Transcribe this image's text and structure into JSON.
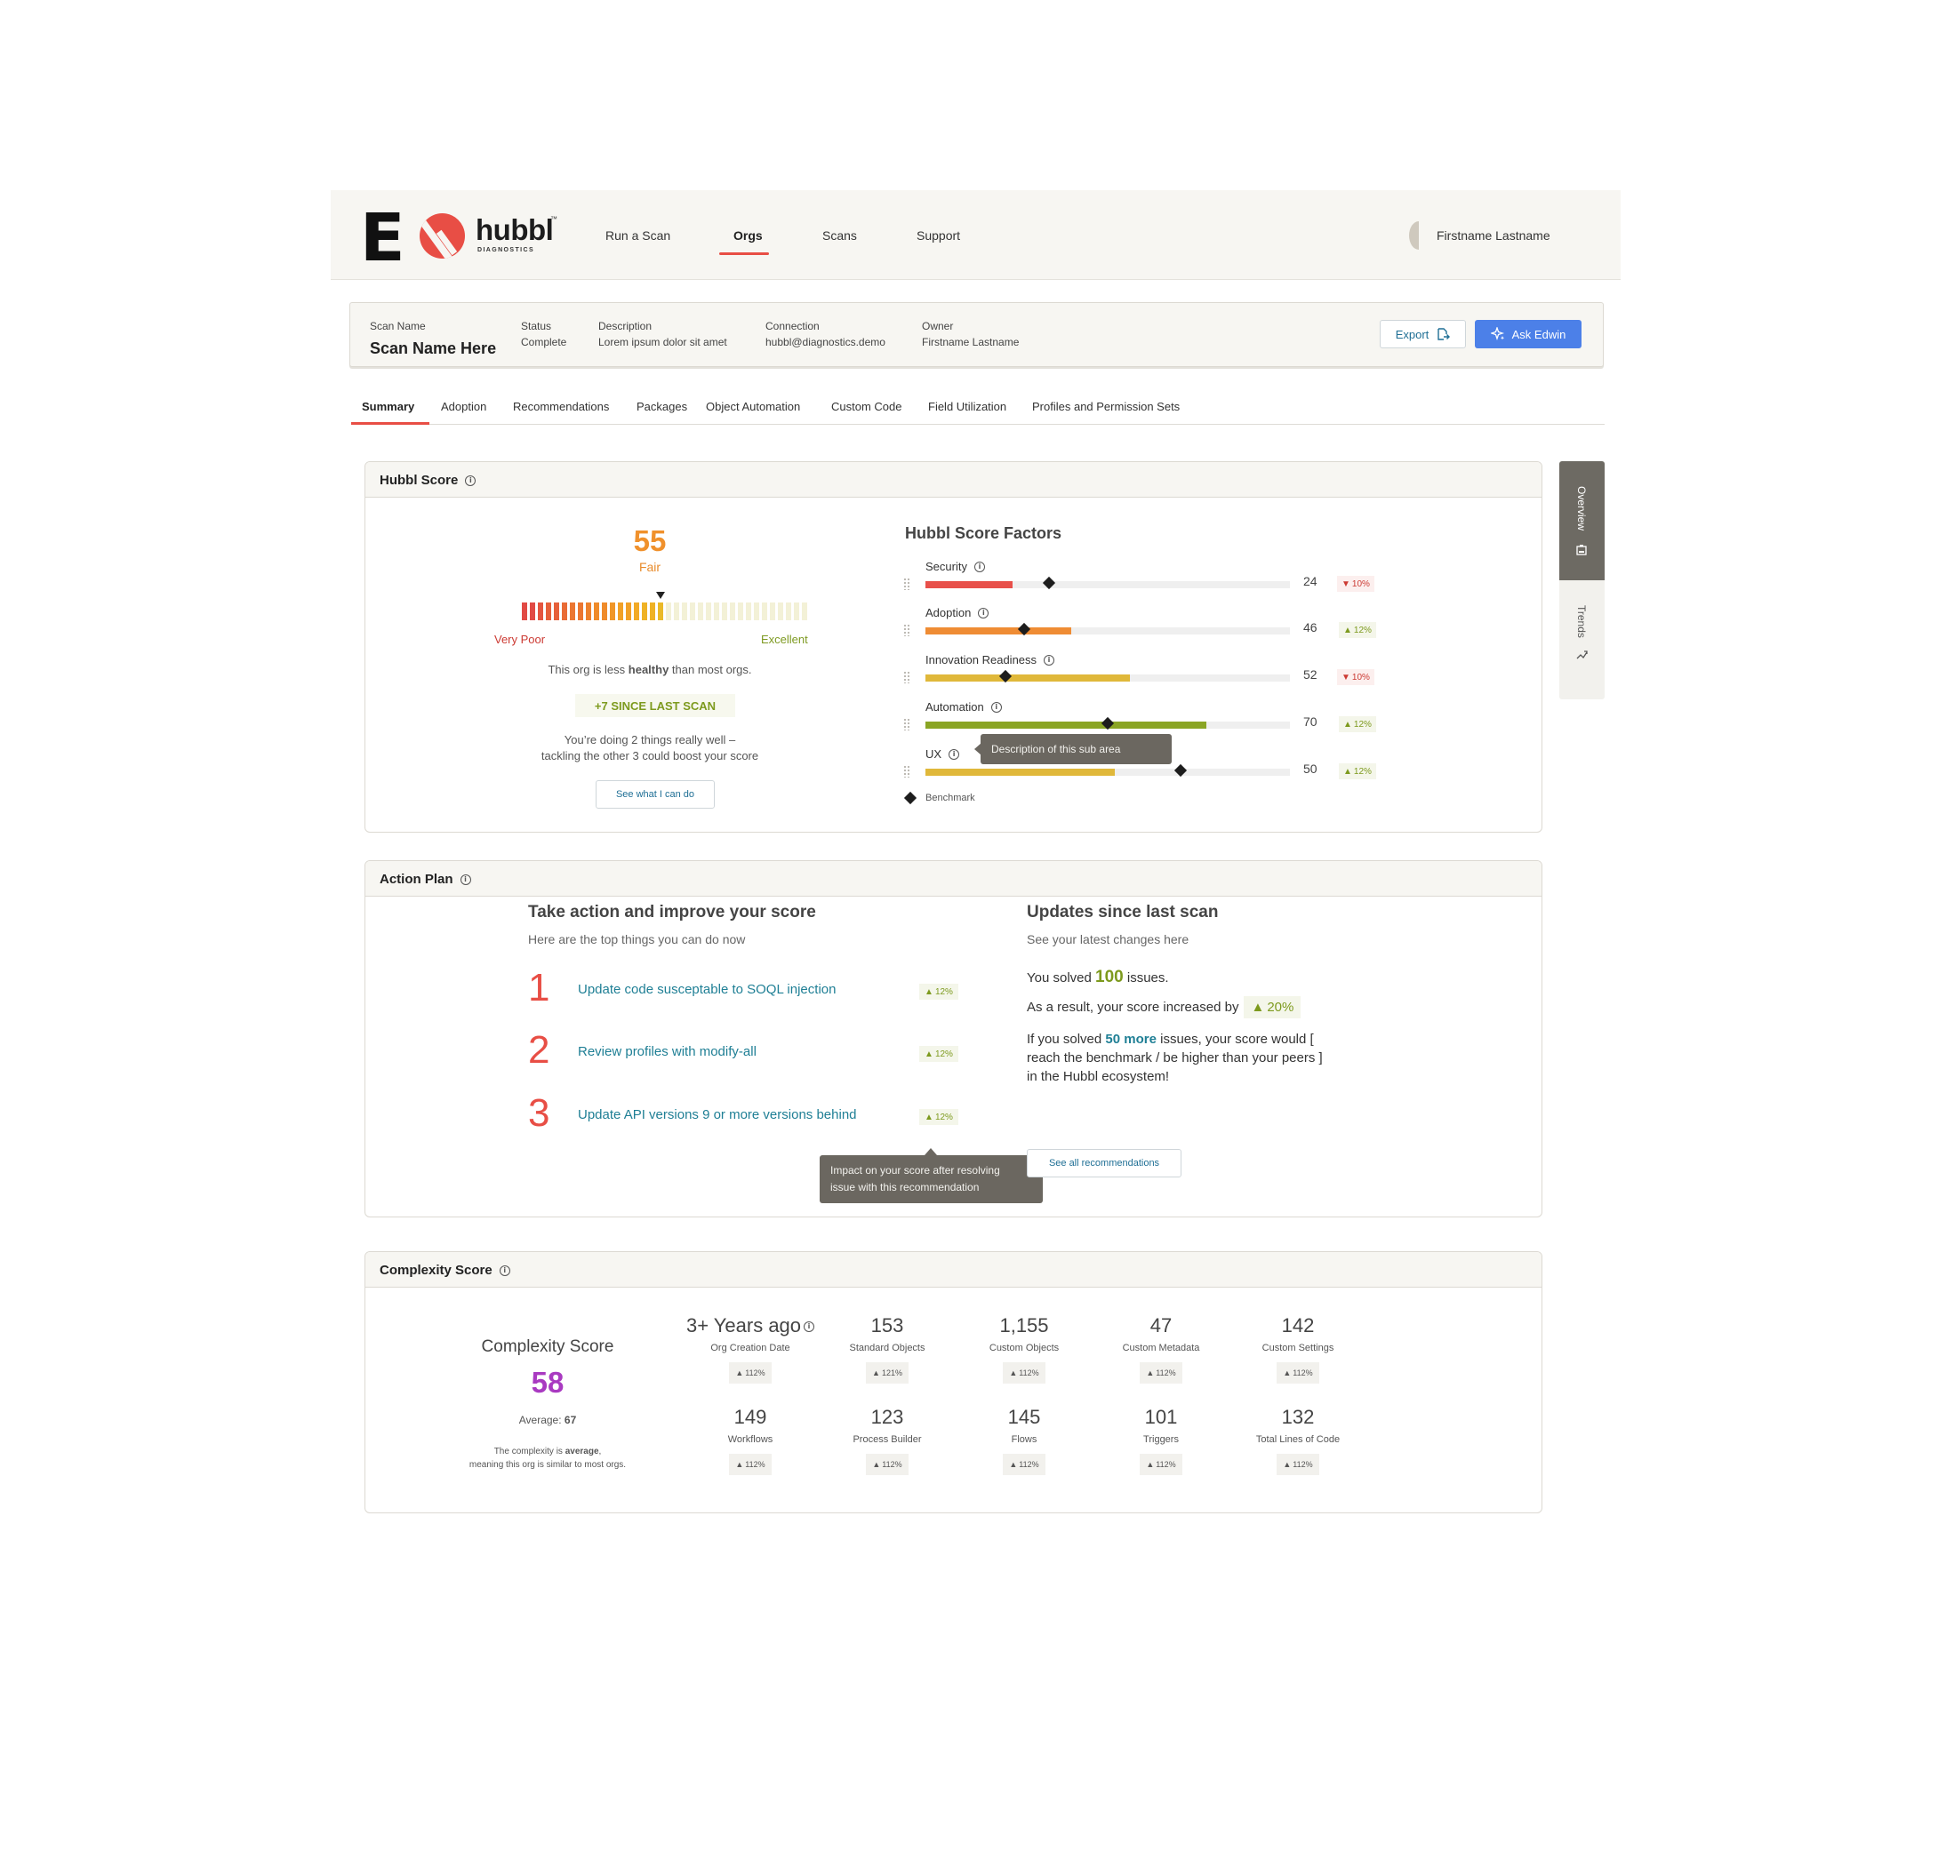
{
  "header": {
    "logo_letter": "E",
    "brand": "hubbl",
    "brand_tm": "™",
    "brand_sub": "DIAGNOSTICS",
    "nav": [
      "Run a Scan",
      "Orgs",
      "Scans",
      "Support"
    ],
    "active_nav": "Orgs",
    "user_name": "Firstname Lastname"
  },
  "scan": {
    "name_label": "Scan Name",
    "name": "Scan Name Here",
    "status_label": "Status",
    "status": "Complete",
    "description_label": "Description",
    "description": "Lorem ipsum dolor sit amet",
    "connection_label": "Connection",
    "connection": "hubbl@diagnostics.demo",
    "owner_label": "Owner",
    "owner": "Firstname Lastname",
    "export_label": "Export",
    "ask_label": "Ask Edwin"
  },
  "tabs": [
    "Summary",
    "Adoption",
    "Recommendations",
    "Packages",
    "Object Automation",
    "Custom Code",
    "Field Utilization",
    "Profiles and Permission Sets"
  ],
  "side_tabs": {
    "overview": "Overview",
    "trends": "Trends"
  },
  "hubbl_score": {
    "title": "Hubbl Score",
    "score": "55",
    "rating": "Fair",
    "gauge_level": 0.5,
    "low_label": "Very Poor",
    "high_label": "Excellent",
    "health_prefix": "This org is less ",
    "health_strong": "healthy",
    "health_suffix": " than most orgs.",
    "since_last": "+7 SINCE LAST SCAN",
    "doing_line1": "You’re doing 2 things really well –",
    "doing_line2": "tackling the other 3 could boost your score",
    "see_button": "See what I can do",
    "factors_title": "Hubbl Score Factors",
    "factors": [
      {
        "name": "Security",
        "value": "24",
        "score": 24,
        "benchmark": 34,
        "delta": "10%",
        "direction": "down",
        "color": "#e8504a"
      },
      {
        "name": "Adoption",
        "value": "46",
        "score": 40,
        "benchmark": 27,
        "delta": "12%",
        "direction": "up",
        "color": "#ef8c34"
      },
      {
        "name": "Innovation Readiness",
        "value": "52",
        "score": 56,
        "benchmark": 22,
        "delta": "10%",
        "direction": "down",
        "color": "#e0b83a"
      },
      {
        "name": "Automation",
        "value": "70",
        "score": 77,
        "benchmark": 50,
        "delta": "12%",
        "direction": "up",
        "color": "#8aa524"
      },
      {
        "name": "UX",
        "value": "50",
        "score": 52,
        "benchmark": 70,
        "delta": "12%",
        "direction": "up",
        "color": "#e0b83a"
      }
    ],
    "tooltip": "Description of this sub area",
    "legend": "Benchmark"
  },
  "action_plan": {
    "title": "Action Plan",
    "left_title": "Take action and improve your score",
    "left_sub": "Here are the top things you can do now",
    "items": [
      {
        "num": "1",
        "text": "Update code susceptable to SOQL injection",
        "delta": "12%"
      },
      {
        "num": "2",
        "text": "Review profiles with modify-all",
        "delta": "12%"
      },
      {
        "num": "3",
        "text": "Update API versions 9 or more versions behind",
        "delta": "12%"
      }
    ],
    "tooltip_line1": "Impact on your score after resolving",
    "tooltip_line2": "issue with this recommendation",
    "right_title": "Updates since last scan",
    "right_sub": "See your latest changes here",
    "solved_prefix": "You solved ",
    "solved_count": "100",
    "solved_suffix": " issues.",
    "result_prefix": "As a result, your score increased by",
    "result_delta": "20%",
    "if_prefix": "If you solved ",
    "if_strong": "50 more",
    "if_suffix": " issues, your score would [",
    "if_line2": "reach the benchmark / be higher than your peers ]",
    "if_line3": "in the Hubbl ecosystem!",
    "all_button": "See all recommendations"
  },
  "complexity": {
    "title": "Complexity Score",
    "inner_title": "Complexity Score",
    "score": "58",
    "avg_prefix": "Average: ",
    "avg_value": "67",
    "desc_prefix": "The complexity is ",
    "desc_strong": "average",
    "desc_suffix": ",",
    "desc_line2": "meaning this org is similar to most orgs.",
    "metrics": [
      {
        "value": "3+ Years ago",
        "label": "Org Creation Date",
        "delta": "112%"
      },
      {
        "value": "153",
        "label": "Standard Objects",
        "delta": "121%"
      },
      {
        "value": "1,155",
        "label": "Custom Objects",
        "delta": "112%"
      },
      {
        "value": "47",
        "label": "Custom Metadata",
        "delta": "112%"
      },
      {
        "value": "142",
        "label": "Custom Settings",
        "delta": "112%"
      },
      {
        "value": "149",
        "label": "Workflows",
        "delta": "112%"
      },
      {
        "value": "123",
        "label": "Process Builder",
        "delta": "112%"
      },
      {
        "value": "145",
        "label": "Flows",
        "delta": "112%"
      },
      {
        "value": "101",
        "label": "Triggers",
        "delta": "112%"
      },
      {
        "value": "132",
        "label": "Total Lines of Code",
        "delta": "112%"
      }
    ]
  },
  "colors": {
    "accent": "#e84e45",
    "primary": "#4c80e8",
    "link": "#1f7f95",
    "positive": "#7d9a1e",
    "negative": "#cc3a33",
    "complexity": "#a93ac1"
  }
}
